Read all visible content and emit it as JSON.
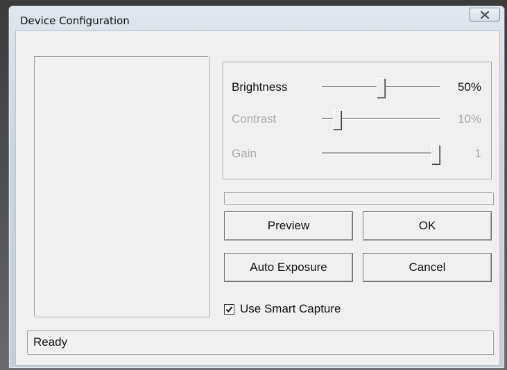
{
  "window": {
    "title": "Device Configuration"
  },
  "sliders": [
    {
      "label": "Brightness",
      "value_text": "50%",
      "level": 0.5,
      "enabled": true
    },
    {
      "label": "Contrast",
      "value_text": "10%",
      "level": 0.1,
      "enabled": false
    },
    {
      "label": "Gain",
      "value_text": "1",
      "level": 1.0,
      "enabled": false
    }
  ],
  "progress": {
    "level": 0
  },
  "buttons": {
    "preview": "Preview",
    "ok": "OK",
    "auto_exposure": "Auto Exposure",
    "cancel": "Cancel"
  },
  "smart_capture": {
    "label": "Use Smart Capture",
    "checked": true
  },
  "status": {
    "text": "Ready"
  },
  "icons": {
    "close": "close-icon",
    "checkmark": "checkmark-icon"
  },
  "colors": {
    "face": "#f0f0f0",
    "disabled_text": "#a8a8a8"
  }
}
